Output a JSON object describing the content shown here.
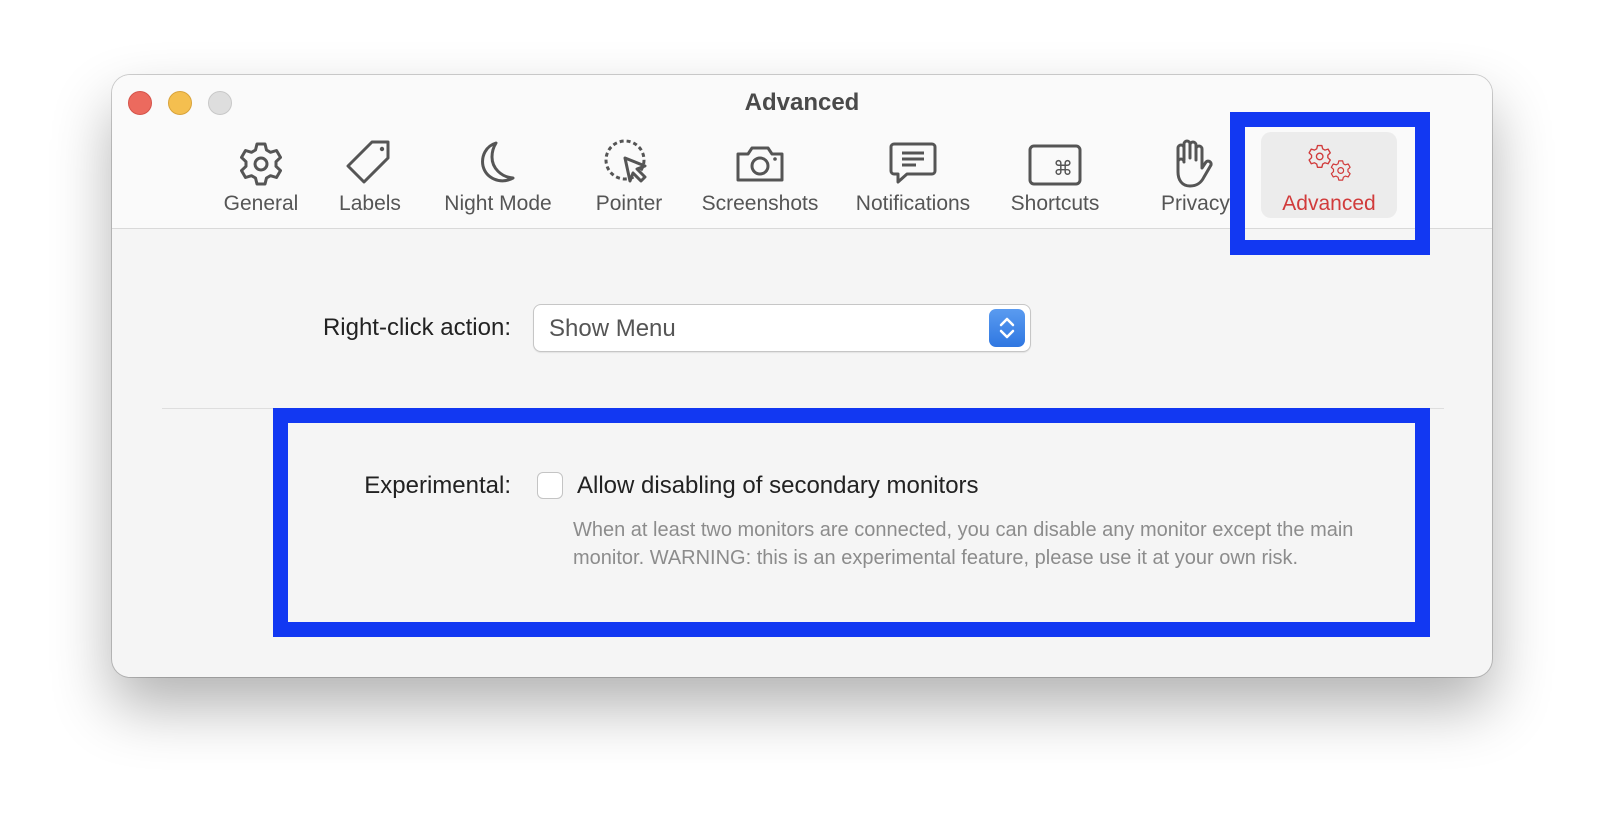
{
  "window": {
    "title": "Advanced",
    "controls": [
      {
        "name": "close",
        "color": "#ec6a5e"
      },
      {
        "name": "minimize",
        "color": "#f4bf4f"
      },
      {
        "name": "zoom",
        "color": "#dedede"
      }
    ]
  },
  "toolbar": {
    "tabs": [
      {
        "label": "General",
        "icon": "gear-icon"
      },
      {
        "label": "Labels",
        "icon": "tag-icon"
      },
      {
        "label": "Night Mode",
        "icon": "moon-icon"
      },
      {
        "label": "Pointer",
        "icon": "pointer-icon"
      },
      {
        "label": "Screenshots",
        "icon": "camera-icon"
      },
      {
        "label": "Notifications",
        "icon": "speech-bubble-icon"
      },
      {
        "label": "Shortcuts",
        "icon": "command-key-icon"
      },
      {
        "label": "Privacy",
        "icon": "hand-icon"
      },
      {
        "label": "Advanced",
        "icon": "gears-icon",
        "active": true
      }
    ],
    "active_color": "#d13b3b"
  },
  "settings": {
    "right_click": {
      "label": "Right-click action:",
      "selected": "Show Menu"
    },
    "experimental": {
      "label": "Experimental:",
      "checkbox_label": "Allow disabling of secondary monitors",
      "checked": false,
      "description": "When at least two monitors are connected, you can disable any monitor except the main monitor. WARNING: this is an experimental feature, please use it at your own risk."
    }
  },
  "annotations": {
    "highlight_color": "#1238f2"
  }
}
